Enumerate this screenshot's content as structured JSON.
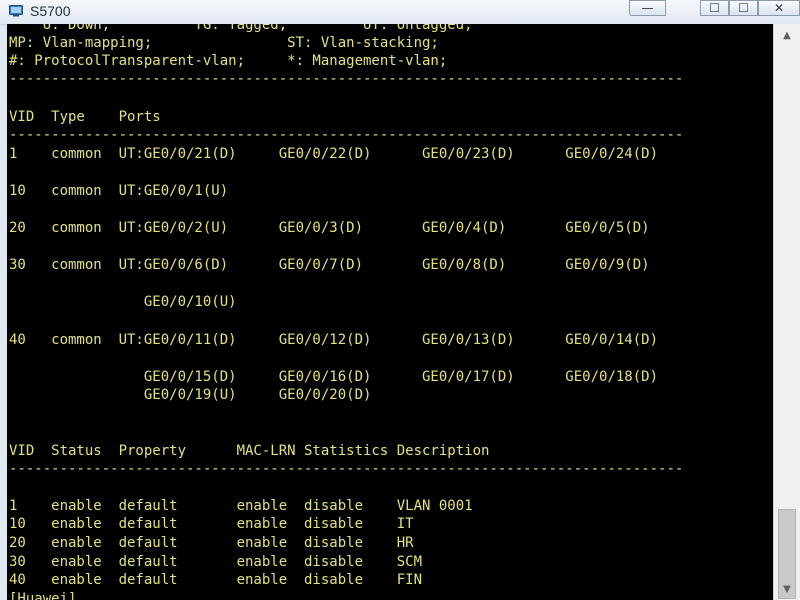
{
  "window": {
    "title": "S5700",
    "minimize_glyph": "—",
    "maximize_glyph": "☐",
    "close_glyph": "✕"
  },
  "terminal": {
    "lines": [
      "    U: Down;          TG: Tagged;         UT: Untagged;",
      "MP: Vlan-mapping;                ST: Vlan-stacking;",
      "#: ProtocolTransparent-vlan;     *: Management-vlan;",
      "--------------------------------------------------------------------------------",
      "VID  Type    Ports",
      "--------------------------------------------------------------------------------",
      "1    common  UT:GE0/0/21(D)     GE0/0/22(D)      GE0/0/23(D)      GE0/0/24(D)",
      "10   common  UT:GE0/0/1(U)",
      "20   common  UT:GE0/0/2(U)      GE0/0/3(D)       GE0/0/4(D)       GE0/0/5(D)",
      "30   common  UT:GE0/0/6(D)      GE0/0/7(D)       GE0/0/8(D)       GE0/0/9(D)",
      "                GE0/0/10(U)",
      "40   common  UT:GE0/0/11(D)     GE0/0/12(D)      GE0/0/13(D)      GE0/0/14(D)",
      "                GE0/0/15(D)     GE0/0/16(D)      GE0/0/17(D)      GE0/0/18(D)",
      "                GE0/0/19(U)     GE0/0/20(D)",
      "VID  Status  Property      MAC-LRN Statistics Description",
      "--------------------------------------------------------------------------------",
      "1    enable  default       enable  disable    VLAN 0001",
      "10   enable  default       enable  disable    IT",
      "20   enable  default       enable  disable    HR",
      "30   enable  default       enable  disable    SCM",
      "40   enable  default       enable  disable    FIN",
      "[Huawei]"
    ]
  },
  "scrollbar": {
    "up_glyph": "▲",
    "down_glyph": "▼"
  }
}
